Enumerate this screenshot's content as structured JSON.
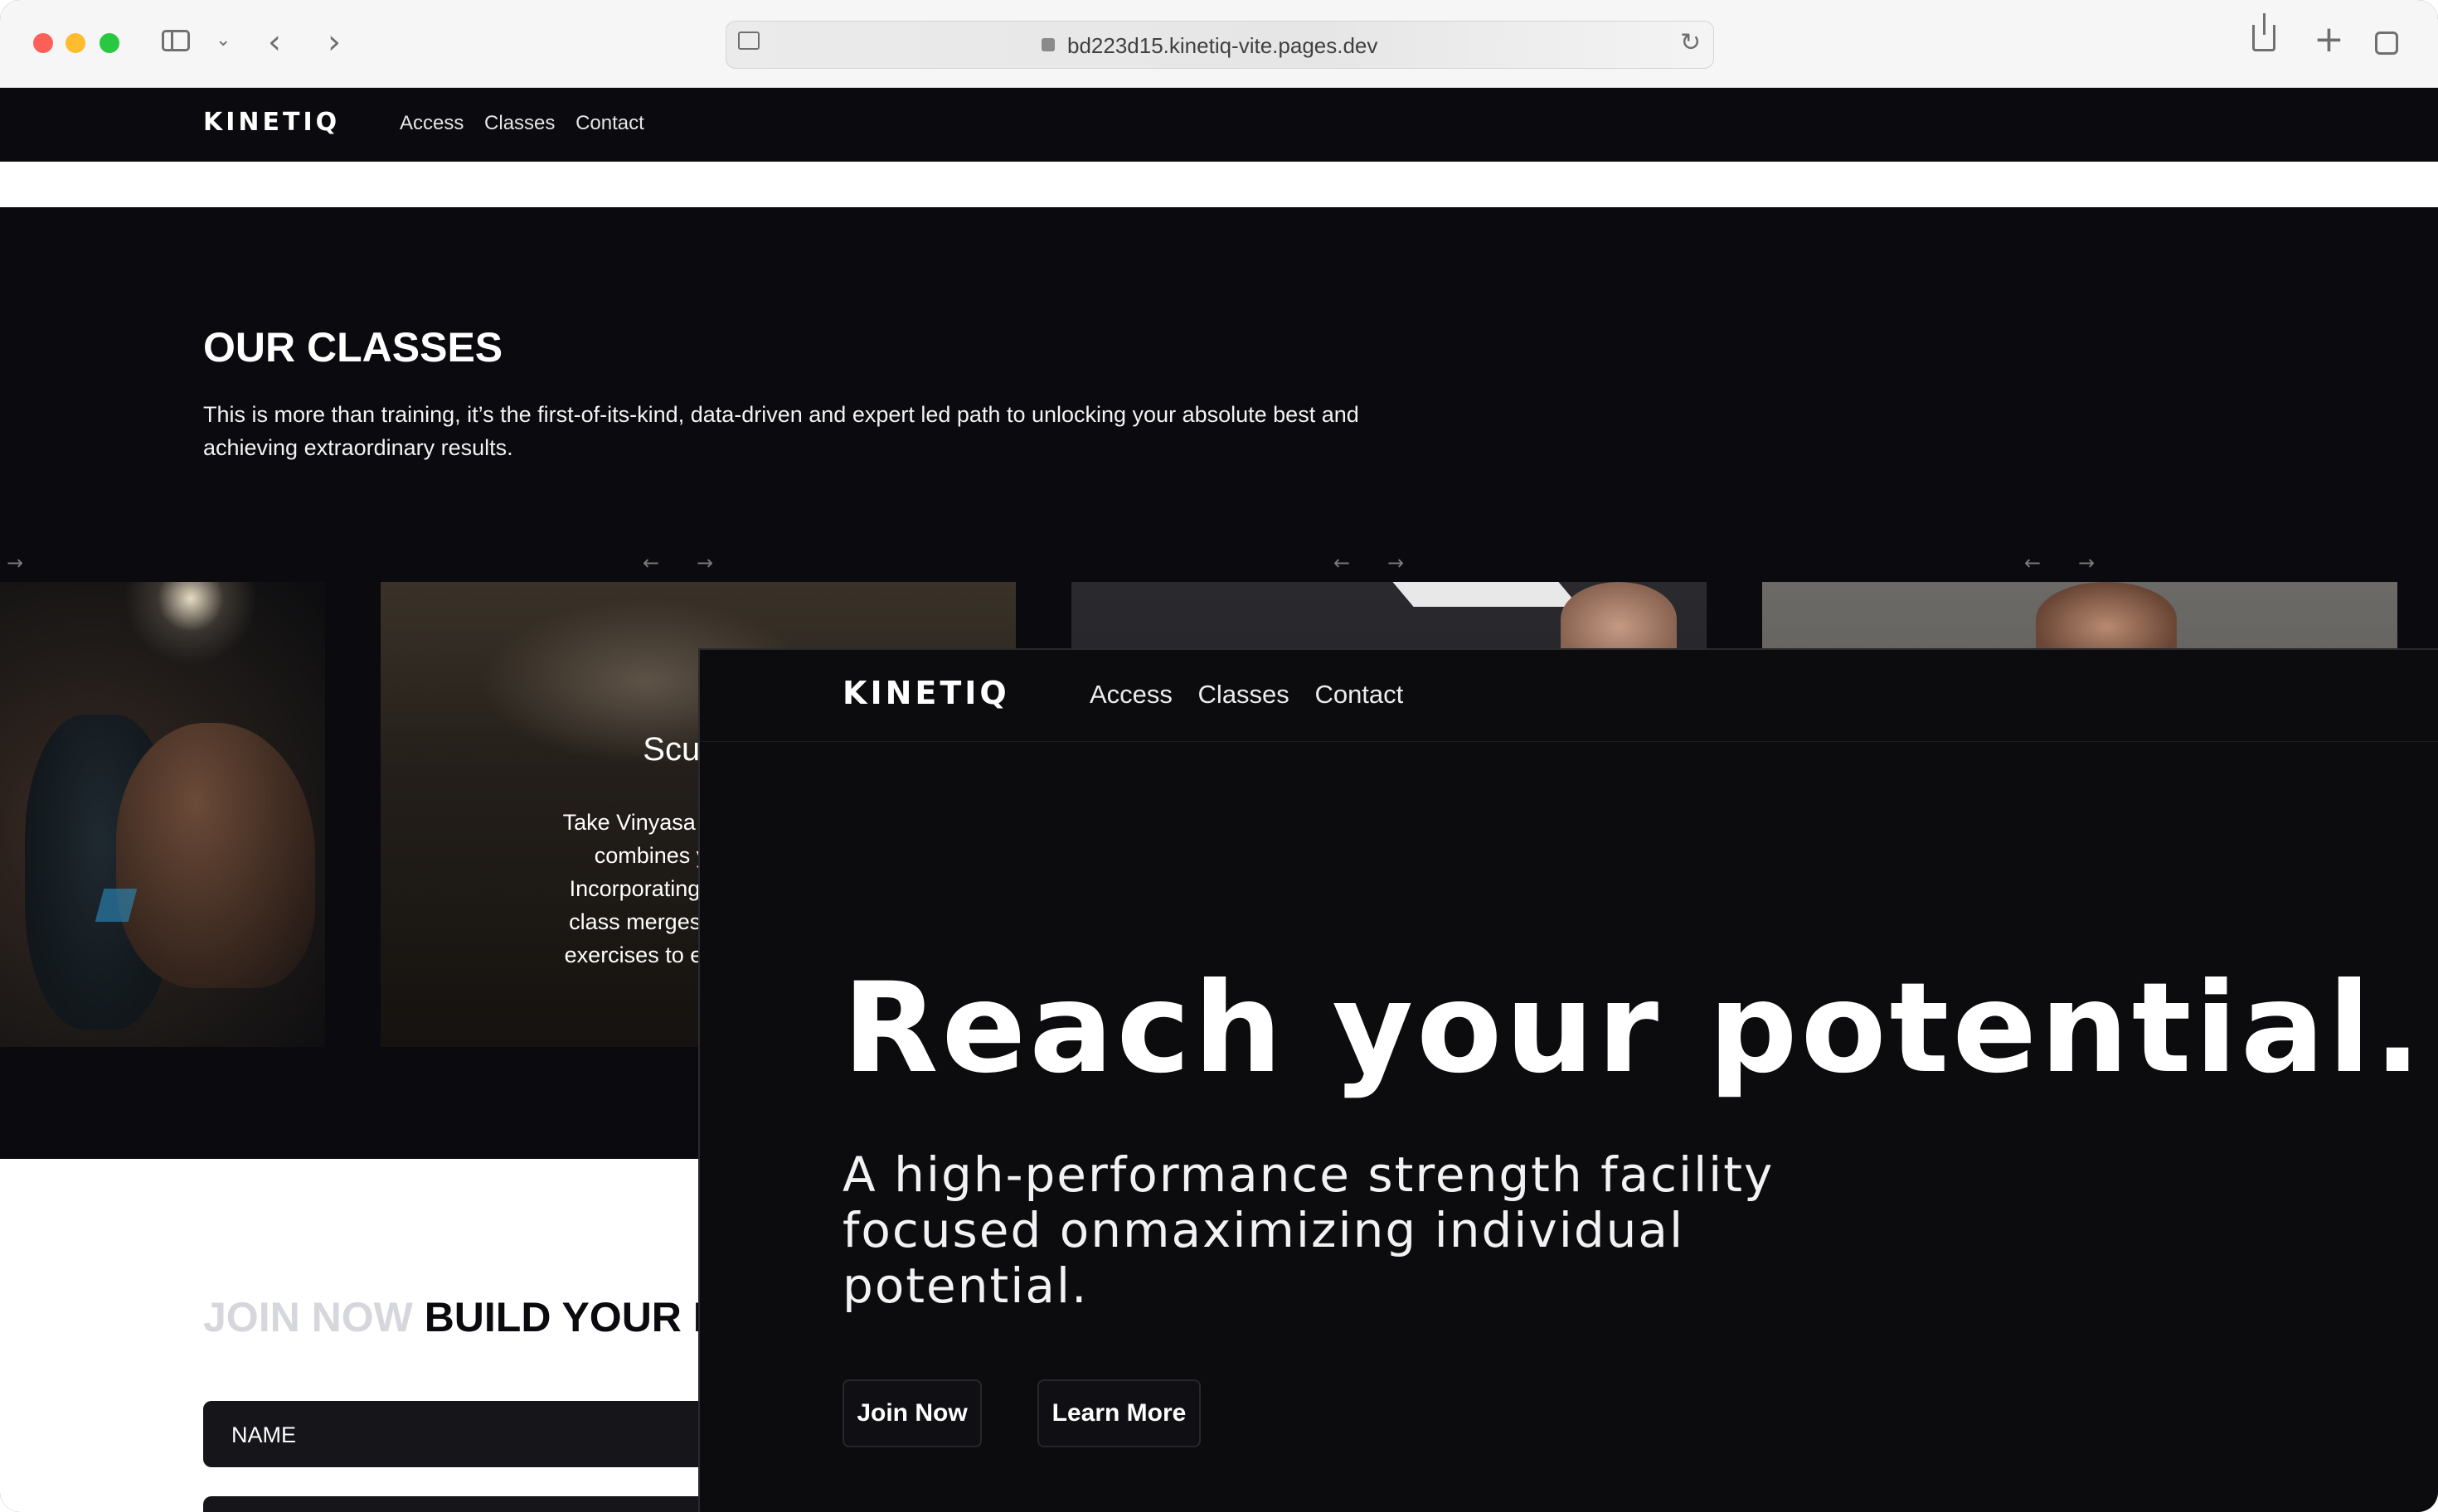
{
  "browser": {
    "url": "bd223d15.kinetiq-vite.pages.dev"
  },
  "back_page": {
    "logo": "KINETIQ",
    "nav": [
      "Access",
      "Classes",
      "Contact"
    ],
    "classes": {
      "title": "OUR CLASSES",
      "description": "This is more than training, it’s the first-of-its-kind, data-driven and expert led path to unlocking your absolute best and achieving extraordinary results.",
      "card_title": "Sculpte",
      "card_text_lines": [
        "Take Vinyasa up a notch wi",
        "combines yoga with l",
        "Incorporating Bala Bangle",
        "class merges Vinyasa flov",
        "exercises to enhance stren"
      ]
    },
    "join": {
      "muted": "JOIN NOW",
      "strong": "BUILD YOUR E",
      "name_placeholder": "NAME"
    },
    "arrows": {
      "left": "←",
      "right": "→"
    }
  },
  "front_page": {
    "logo": "KINETIQ",
    "nav": [
      "Access",
      "Classes",
      "Contact"
    ],
    "hero_title": "Reach your potential.",
    "hero_subtitle_lines": [
      "A high-performance strength facility",
      "focused onmaximizing individual",
      "potential."
    ],
    "buttons": {
      "join": "Join Now",
      "learn": "Learn More"
    }
  }
}
